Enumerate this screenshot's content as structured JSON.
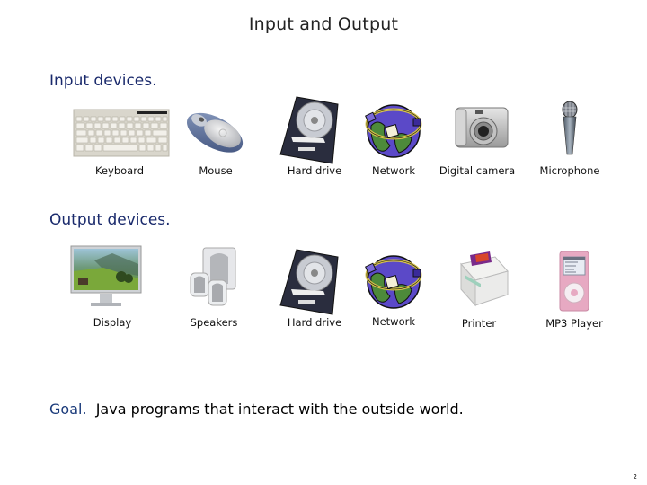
{
  "slide": {
    "title": "Input and Output",
    "page_number": "2"
  },
  "input_section": {
    "heading": "Input devices.",
    "items": [
      {
        "label": "Keyboard",
        "icon": "keyboard-icon"
      },
      {
        "label": "Mouse",
        "icon": "mouse-icon"
      },
      {
        "label": "Hard drive",
        "icon": "hard-drive-icon"
      },
      {
        "label": "Network",
        "icon": "network-globe-icon"
      },
      {
        "label": "Digital camera",
        "icon": "digital-camera-icon"
      },
      {
        "label": "Microphone",
        "icon": "microphone-icon"
      }
    ]
  },
  "output_section": {
    "heading": "Output devices.",
    "items": [
      {
        "label": "Display",
        "icon": "display-icon"
      },
      {
        "label": "Speakers",
        "icon": "speakers-icon"
      },
      {
        "label": "Hard drive",
        "icon": "hard-drive-icon"
      },
      {
        "label": "Network",
        "icon": "network-globe-icon"
      },
      {
        "label": "Printer",
        "icon": "printer-icon"
      },
      {
        "label": "MP3 Player",
        "icon": "mp3-player-icon"
      }
    ]
  },
  "goal": {
    "lead": "Goal.",
    "text": "Java programs that interact with the outside world."
  },
  "colors": {
    "heading": "#1a2a6c",
    "goal_lead": "#1a3a7a"
  }
}
